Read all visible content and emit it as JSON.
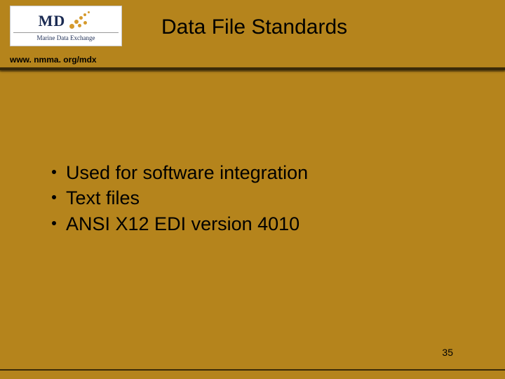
{
  "logo": {
    "main": "MD",
    "sub": "Marine Data Exchange"
  },
  "header": {
    "title": "Data File Standards",
    "url": "www. nmma. org/mdx"
  },
  "bullets": [
    "Used for software integration",
    "Text files",
    "ANSI X12 EDI version 4010"
  ],
  "page_number": "35"
}
